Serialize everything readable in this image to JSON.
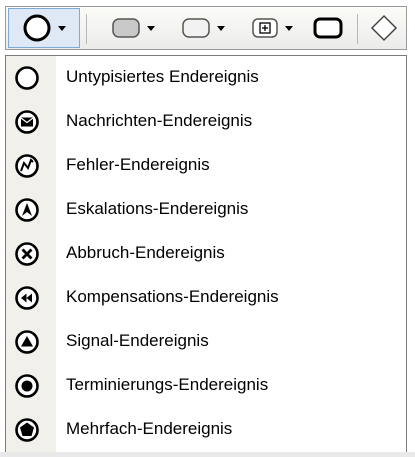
{
  "toolbar": {
    "buttons": [
      {
        "icon": "end-event-circle-icon"
      },
      {
        "icon": "task-rounded-rect-icon"
      },
      {
        "icon": "subprocess-rounded-rect-icon"
      },
      {
        "icon": "collapsed-subprocess-icon"
      },
      {
        "icon": "call-activity-icon"
      },
      {
        "icon": "gateway-diamond-icon"
      }
    ]
  },
  "menu": {
    "items": [
      {
        "label": "Untypisiertes Endereignis",
        "icon": "untyped-end-event-icon"
      },
      {
        "label": "Nachrichten-Endereignis",
        "icon": "message-end-event-icon"
      },
      {
        "label": "Fehler-Endereignis",
        "icon": "error-end-event-icon"
      },
      {
        "label": "Eskalations-Endereignis",
        "icon": "escalation-end-event-icon"
      },
      {
        "label": "Abbruch-Endereignis",
        "icon": "cancel-end-event-icon"
      },
      {
        "label": "Kompensations-Endereignis",
        "icon": "compensation-end-event-icon"
      },
      {
        "label": "Signal-Endereignis",
        "icon": "signal-end-event-icon"
      },
      {
        "label": "Terminierungs-Endereignis",
        "icon": "terminate-end-event-icon"
      },
      {
        "label": "Mehrfach-Endereignis",
        "icon": "multiple-end-event-icon"
      }
    ]
  }
}
